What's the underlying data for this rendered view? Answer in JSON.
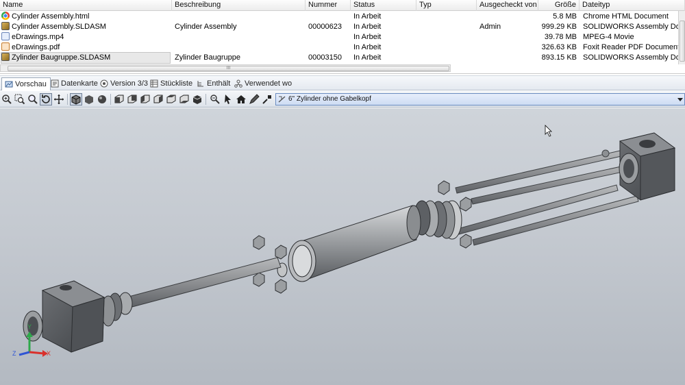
{
  "filelist": {
    "columns": [
      "Name",
      "Beschreibung",
      "Nummer",
      "Status",
      "Typ",
      "Ausgecheckt von",
      "Größe",
      "Dateityp"
    ],
    "rows": [
      {
        "icon": "chrome-icon",
        "name": "Cylinder Assembly.html",
        "beschreibung": "",
        "nummer": "",
        "status": "In Arbeit",
        "typ": "",
        "ausgecheckt": "",
        "groesse": "5.8 MB",
        "dateityp": "Chrome HTML Document"
      },
      {
        "icon": "solidworks-assembly-icon",
        "name": "Cylinder Assembly.SLDASM",
        "beschreibung": "Cylinder Assembly",
        "nummer": "00000623",
        "status": "In Arbeit",
        "typ": "",
        "ausgecheckt": "Admin",
        "groesse": "999.29 KB",
        "dateityp": "SOLIDWORKS Assembly Documen"
      },
      {
        "icon": "video-file-icon",
        "name": "eDrawings.mp4",
        "beschreibung": "",
        "nummer": "",
        "status": "In Arbeit",
        "typ": "",
        "ausgecheckt": "",
        "groesse": "39.78 MB",
        "dateityp": "MPEG-4 Movie"
      },
      {
        "icon": "pdf-file-icon",
        "name": "eDrawings.pdf",
        "beschreibung": "",
        "nummer": "",
        "status": "In Arbeit",
        "typ": "",
        "ausgecheckt": "",
        "groesse": "326.63 KB",
        "dateityp": "Foxit Reader PDF Document"
      },
      {
        "icon": "solidworks-assembly-icon",
        "name": "Zylinder Baugruppe.SLDASM",
        "beschreibung": "Zylinder Baugruppe",
        "nummer": "00003150",
        "status": "In Arbeit",
        "typ": "",
        "ausgecheckt": "",
        "groesse": "893.15 KB",
        "dateityp": "SOLIDWORKS Assembly Documen"
      }
    ],
    "selected_row": 4,
    "scroll_grip": "III"
  },
  "tabs": [
    {
      "label": "Vorschau",
      "icon": "preview-icon",
      "active": true
    },
    {
      "label": "Datenkarte",
      "icon": "datacard-icon"
    },
    {
      "label": "Version 3/3",
      "icon": "version-icon"
    },
    {
      "label": "Stückliste",
      "icon": "bom-icon"
    },
    {
      "label": "Enthält",
      "icon": "contains-icon"
    },
    {
      "label": "Verwendet wo",
      "icon": "where-used-icon"
    }
  ],
  "toolbar": {
    "configuration": "6\" Zylinder ohne Gabelkopf",
    "tools": [
      "zoom-fit-icon",
      "zoom-area-icon",
      "zoom-icon",
      "rotate-icon",
      "pan-icon",
      "shaded-edges-icon",
      "shaded-icon",
      "realview-icon",
      "view-front-icon",
      "view-back-icon",
      "view-left-icon",
      "view-right-icon",
      "view-top-icon",
      "view-bottom-icon",
      "view-iso-icon",
      "measure-icon",
      "select-icon",
      "home-icon",
      "markup-icon",
      "zoom-select-icon"
    ]
  },
  "viewport": {
    "triad": {
      "x": "X",
      "y": "Y",
      "z": "Z"
    },
    "colors": {
      "bg_top": "#cfd4da",
      "bg_bottom": "#b3b9c1",
      "part": "#8a8c8f",
      "part_dark": "#55585c",
      "accent_x": "#d9302c",
      "accent_y": "#2ea84a",
      "accent_z": "#2f55d4"
    }
  }
}
